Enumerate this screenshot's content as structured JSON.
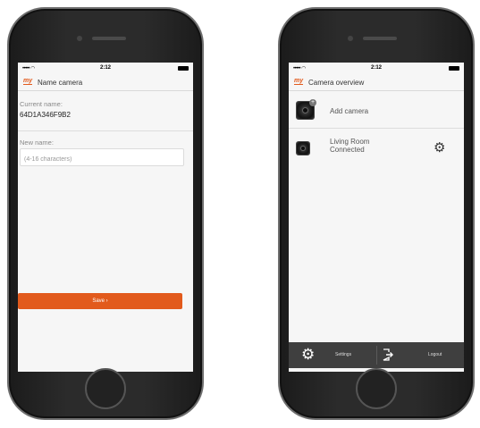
{
  "status_bar": {
    "signal": "••••• ◠",
    "time": "2:12"
  },
  "left_screen": {
    "logo": "my",
    "title": "Name camera",
    "current_name_label": "Current name:",
    "current_name_value": "64D1A346F9B2",
    "new_name_label": "New name:",
    "new_name_placeholder": "(4-16 characters)",
    "save_button": "Save ›"
  },
  "right_screen": {
    "logo": "my",
    "title": "Camera overview",
    "add_camera_label": "Add camera",
    "cameras": [
      {
        "name": "Living Room",
        "status": "Connected"
      }
    ],
    "bottom_bar": {
      "settings_label": "Settings",
      "logout_label": "Logout"
    }
  },
  "colors": {
    "accent": "#e25a1c",
    "bottom_bar": "#3f3f3f",
    "screen_bg": "#f6f6f6"
  }
}
